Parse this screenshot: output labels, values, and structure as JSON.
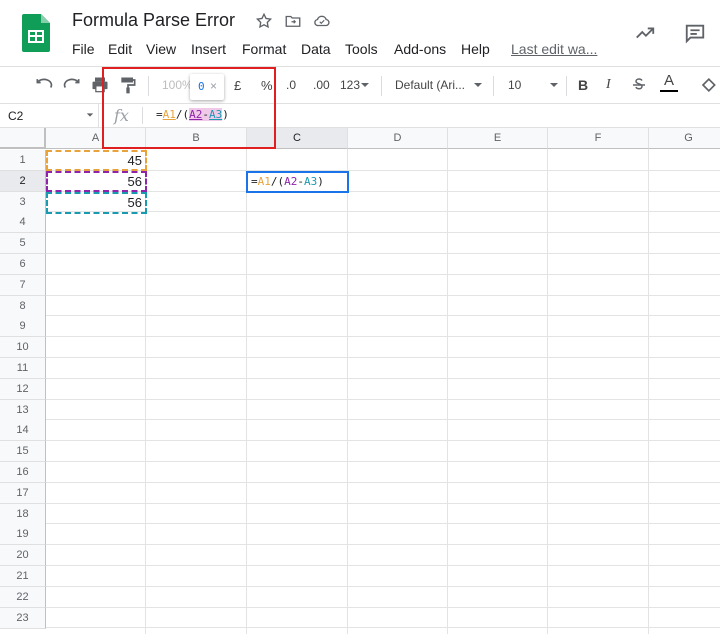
{
  "header": {
    "doc_title": "Formula Parse Error",
    "menu": [
      "File",
      "Edit",
      "View",
      "Insert",
      "Format",
      "Data",
      "Tools",
      "Add-ons",
      "Help"
    ],
    "last_edit": "Last edit wa..."
  },
  "toolbar": {
    "zoom": "100%",
    "currency": "£",
    "percent": "%",
    "dec_decrease": ".0",
    "dec_increase": ".00",
    "more_formats": "123",
    "font": "Default (Ari...",
    "font_size": "10",
    "bold": "B",
    "italic": "I",
    "text_color": "A"
  },
  "formula_bar": {
    "name_box": "C2",
    "fx": "fx",
    "formula_parts": {
      "eq": "=",
      "a1": "A1",
      "slash": "/",
      "open": "(",
      "a2": "A2",
      "minus": "-",
      "a3": "A3",
      "close": ")"
    }
  },
  "tooltip": {
    "value": "0",
    "close": "×"
  },
  "columns": [
    "A",
    "B",
    "C",
    "D",
    "E",
    "F",
    "G"
  ],
  "rows": [
    "1",
    "2",
    "3",
    "4",
    "5",
    "6",
    "7",
    "8",
    "9",
    "10",
    "11",
    "12",
    "13",
    "14",
    "15",
    "16",
    "17",
    "18",
    "19",
    "20",
    "21",
    "22",
    "23"
  ],
  "cells": {
    "A1": "45",
    "A2": "56",
    "A3": "56",
    "C2": {
      "eq": "=",
      "a1": "A1",
      "slash": "/",
      "open": "(",
      "a2": "A2",
      "minus": "-",
      "a3": "A3",
      "close": ")"
    }
  },
  "colors": {
    "ref1": "#e8a33d",
    "ref2": "#8e24aa",
    "ref3": "#1a9ab0",
    "active": "#1a73e8",
    "annotation": "#e02020"
  }
}
